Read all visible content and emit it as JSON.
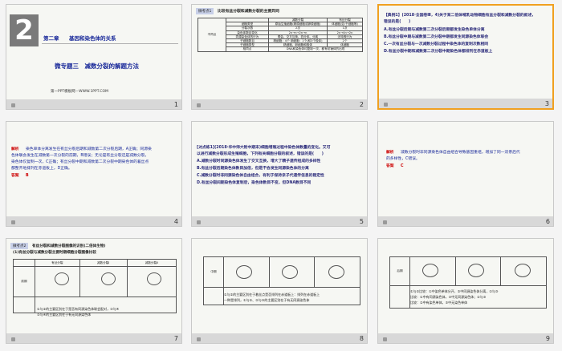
{
  "slides": [
    {
      "num": "1",
      "chapter_digit": "2",
      "chapter": "第二章",
      "chapter_title": "基因和染色体的关系",
      "topic": "微专题三　减数分裂的解题方法",
      "footer": "第一PPT模板网－WWW.1PPT.COM"
    },
    {
      "num": "2",
      "heading_tag": "微考点1",
      "heading": "比较有丝分裂和减数分裂的主要异同",
      "col_headers": [
        "",
        "减数分裂",
        "有丝分裂"
      ],
      "side_label": "不同点",
      "rows": [
        [
          "细胞类型",
          "原始生殖细胞(精原细胞或卵原细胞)",
          "体细胞(如:干细胞等)"
        ],
        [
          "分裂次数",
          "2次",
          "1次"
        ],
        [
          "染色体数目变化",
          "2n→n→2n→n",
          "2n→4n→2n"
        ],
        [
          "同源染色体的行为",
          "联会、交叉互换、四分体、分离",
          "无特殊行为"
        ],
        [
          "子细胞数目",
          "精细胞：4个 卵细胞：1个(和3个极体)",
          "2个"
        ],
        [
          "子细胞类型",
          "精细胞、卵细胞和极体",
          "体细胞"
        ]
      ],
      "similar_label": "相同点",
      "similar_text": "DNA和染色体均复制一次，都有纺锤体的出现"
    },
    {
      "num": "3",
      "question_lines": [
        "【典例1】(2018·全国卷Ⅲ，4)关于某二倍体哺乳动物细胞有丝分裂和减数分裂的叙述，",
        "错误的是(　　)",
        "A.有丝分裂后期与减数第二次分裂后期都发生染色单体分离",
        "B.有丝分裂中期与减数第二次分裂中期都发生同源染色体联会",
        "C.一次有丝分裂与一次减数分裂过程中染色体的复制次数相同",
        "D.有丝分裂中期和减数第二次分裂中期染色体都排列在赤道板上"
      ]
    },
    {
      "num": "4",
      "analysis_label": "解析",
      "analysis_lines": [
        "染色单体分离发生在有丝分裂后期和减数第二次分裂后期，A正确；同源染",
        "色体联会发生在减数第一次分裂的前期，B错误；无论是有丝分裂还是减数分裂，",
        "染色体仅复制一次，C正确；有丝分裂中期和减数第二次分裂中期染色体的着丝点",
        "都整齐地排列在赤道板上，D正确。"
      ],
      "answer_label": "答案",
      "answer": "B"
    },
    {
      "num": "5",
      "question_lines": [
        "[对点练1](2018·华中师大附中期末)细胞增殖过程中染色体数量的变化。又可",
        "以进行减数分裂形成生殖细胞，下列有关细胞分裂的叙述，错误的是(　　)",
        "A.减数分裂时同源染色体发生了交叉互换，增大了精子遗传组成的多样性",
        "B.有丝分裂后期染色体数目加倍，但是不会发生同源染色体的分离",
        "C.减数分裂时非同源染色体自由组合，有利于保持亲子代遗传信息的稳定性",
        "D.有丝分裂间期染色体复制后，染色体数目不变，但DNA数目不同"
      ]
    },
    {
      "num": "6",
      "analysis_label": "解析",
      "analysis_lines": [
        "减数分裂时非同源染色体自由组合导致基因重组，增加了同一双亲后代",
        "的多样性，C错误。"
      ],
      "answer_label": "答案",
      "answer": "C"
    },
    {
      "num": "7",
      "heading_tag": "微考点2",
      "heading": "有丝分裂和减数分裂图像的识别(二倍体生物)",
      "subheading": "(1)有丝分裂与减数分裂主要时期细胞分裂图像比较",
      "col_headers": [
        "",
        "有丝分裂",
        "减数分裂Ⅰ",
        "减数分裂Ⅱ"
      ],
      "row_label": "前期",
      "note_lines": [
        "①与②的主要区别在于是否有同源染色体联会配对，③与④",
        "③与④的主要区别在于有无同源染色体"
      ]
    },
    {
      "num": "8",
      "row_label": "中期",
      "note_lines": [
        "①与②的主要区别在于着丝点是否排列在赤道板上：排列在赤道板上",
        "一种是排列，①与②、②与③的主要区别在于有无同源染色体"
      ]
    },
    {
      "num": "9",
      "row_label": "后期",
      "note_lines": [
        "①与②比较：①中染色单体分开，②中同源染色体分离，①与③",
        "比较：①中有同源染色体，③中无同源染色体；②与③",
        "比较：②中有染色单体，③中无染色单体"
      ]
    }
  ],
  "colors": {
    "accent": "#1a2a9a",
    "answer": "#cc0000",
    "selected_border": "#f0a020"
  }
}
